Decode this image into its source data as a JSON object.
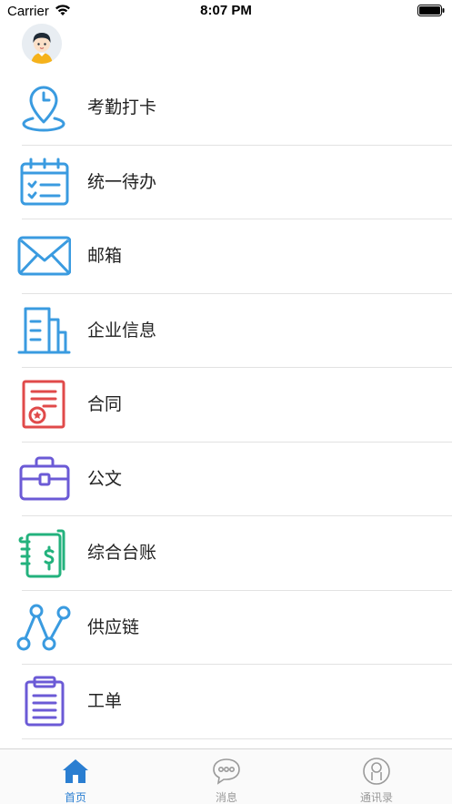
{
  "status_bar": {
    "carrier": "Carrier",
    "time": "8:07 PM"
  },
  "menu": {
    "items": [
      {
        "label": "考勤打卡",
        "icon": "location-pin-icon",
        "color": "#3a9be0"
      },
      {
        "label": "统一待办",
        "icon": "calendar-todo-icon",
        "color": "#3a9be0"
      },
      {
        "label": "邮箱",
        "icon": "mail-icon",
        "color": "#3a9be0"
      },
      {
        "label": "企业信息",
        "icon": "building-icon",
        "color": "#3a9be0"
      },
      {
        "label": "合同",
        "icon": "contract-icon",
        "color": "#e04a4a"
      },
      {
        "label": "公文",
        "icon": "briefcase-icon",
        "color": "#6b5ad6"
      },
      {
        "label": "综合台账",
        "icon": "ledger-icon",
        "color": "#23b27d"
      },
      {
        "label": "供应链",
        "icon": "supply-chain-icon",
        "color": "#3a9be0"
      },
      {
        "label": "工单",
        "icon": "clipboard-icon",
        "color": "#6b5ad6"
      }
    ]
  },
  "tab_bar": {
    "tabs": [
      {
        "label": "首页",
        "icon": "home-icon",
        "active": true
      },
      {
        "label": "消息",
        "icon": "message-icon",
        "active": false
      },
      {
        "label": "通讯录",
        "icon": "contacts-icon",
        "active": false
      }
    ],
    "active_color": "#2a7ed1",
    "inactive_color": "#9a9a9a"
  }
}
